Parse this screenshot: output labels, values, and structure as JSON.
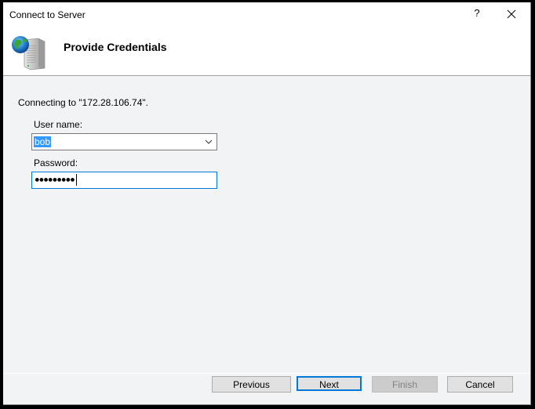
{
  "window": {
    "title": "Connect to Server",
    "help_label": "?",
    "close_icon": "close-icon"
  },
  "header": {
    "icon": "server-globe-icon",
    "heading": "Provide Credentials"
  },
  "main": {
    "connecting_text": "Connecting to \"172.28.106.74\".",
    "username": {
      "label": "User name:",
      "value": "bob",
      "selected": true
    },
    "password": {
      "label": "Password:",
      "masked_value": "●●●●●●●●●",
      "length": 9
    }
  },
  "footer": {
    "previous_label": "Previous",
    "next_label": "Next",
    "finish_label": "Finish",
    "cancel_label": "Cancel",
    "finish_enabled": false,
    "default_button": "Next"
  },
  "colors": {
    "accent": "#0078d7",
    "selection": "#3399ff"
  }
}
